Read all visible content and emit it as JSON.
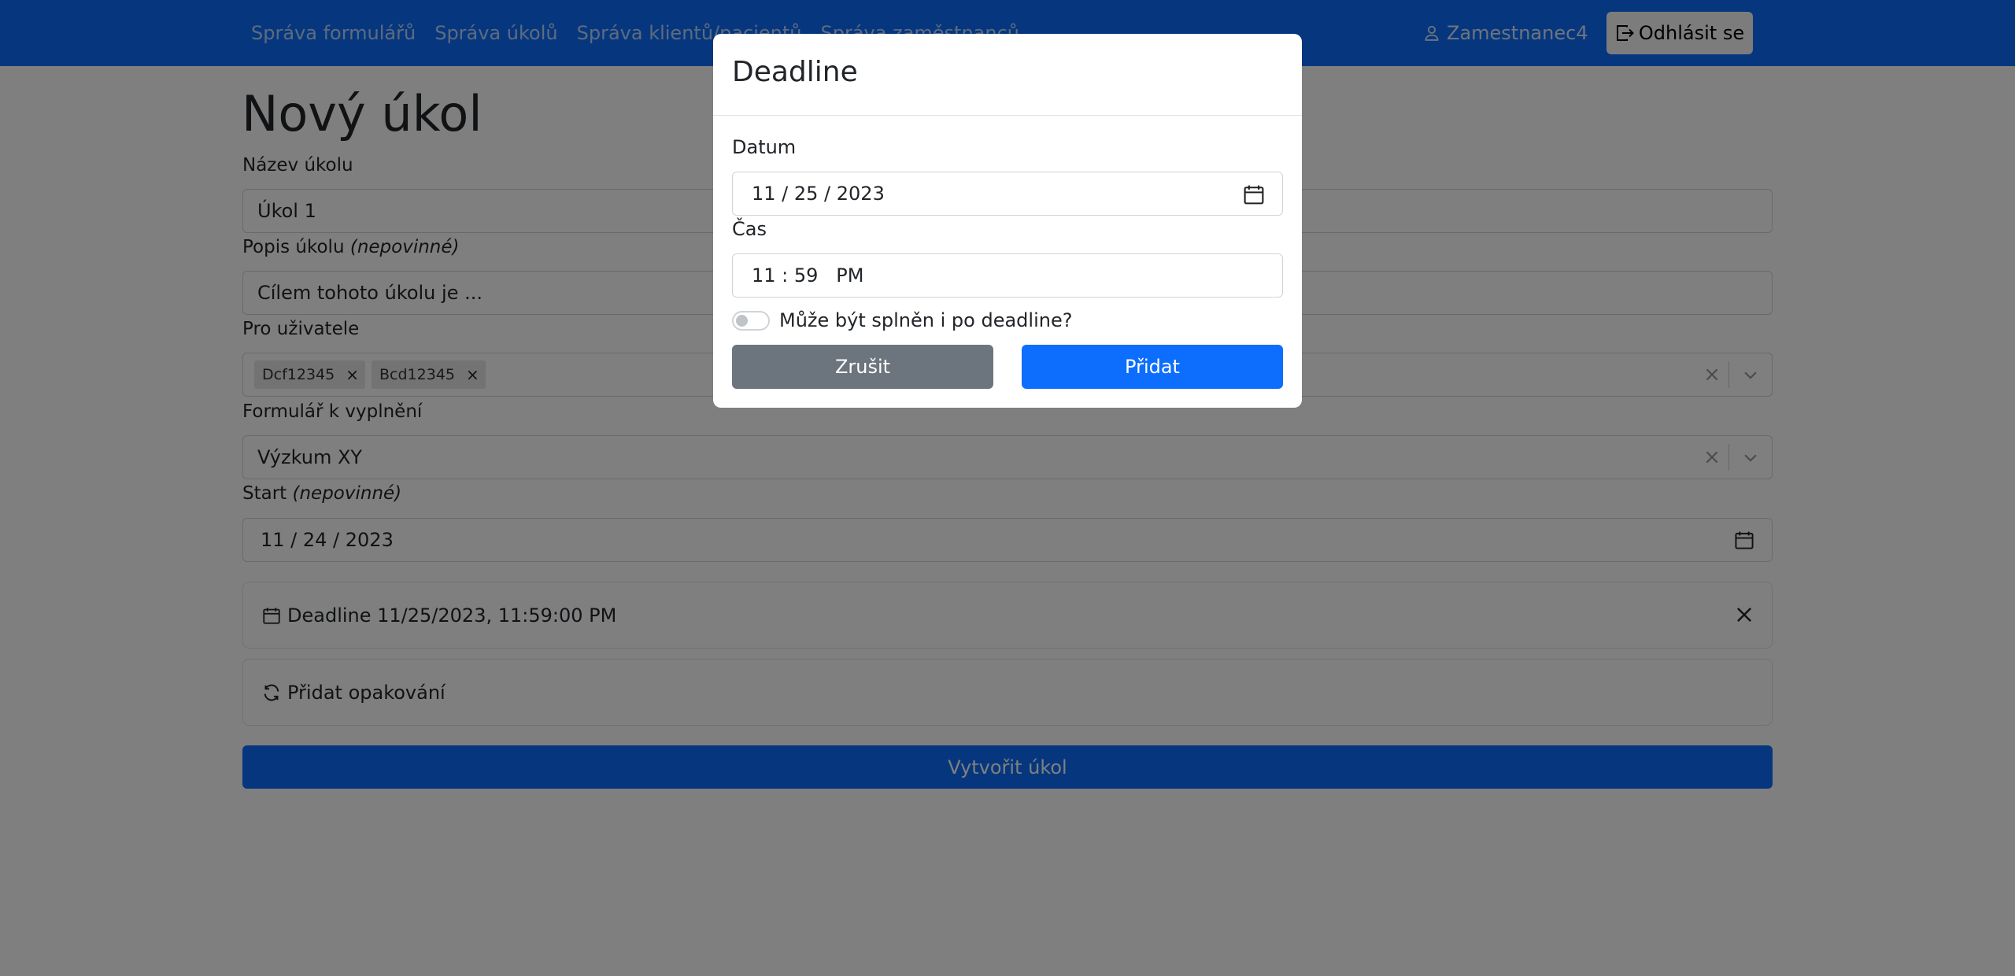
{
  "navbar": {
    "links": [
      "Správa formulářů",
      "Správa úkolů",
      "Správa klientů/pacientů",
      "Správa zaměstnanců"
    ],
    "user": "Zamestnanec4",
    "logout_label": "Odhlásit se"
  },
  "form": {
    "title": "Nový úkol",
    "task_name_label": "Název úkolu",
    "task_name_value": "Úkol 1",
    "description_label": "Popis úkolu",
    "optional_label": "(nepovinné)",
    "description_value": "Cílem tohoto úkolu je ...",
    "users_label": "Pro uživatele",
    "users": [
      "Dcf12345",
      "Bcd12345"
    ],
    "form_label": "Formulář k vyplnění",
    "form_value": "Výzkum XY",
    "start_label": "Start",
    "start_value": "11 / 24 / 2023",
    "deadline_card": "Deadline 11/25/2023, 11:59:00 PM",
    "repeat_card": "Přidat opakování",
    "create_button": "Vytvořit úkol"
  },
  "modal": {
    "title": "Deadline",
    "date_label": "Datum",
    "date_value": "11 / 25 / 2023",
    "time_label": "Čas",
    "time_value": "11 : 59   PM",
    "late_toggle_label": "Může být splněn i po deadline?",
    "late_toggle_on": false,
    "cancel_button": "Zrušit",
    "add_button": "Přidat"
  },
  "colors": {
    "primary": "#0d6efd",
    "secondary": "#6c757d",
    "backdrop": "rgba(0,0,0,0.5)"
  },
  "icons": [
    "person-icon",
    "logout-icon",
    "calendar-icon",
    "chevron-down-icon",
    "close-icon",
    "repeat-icon"
  ]
}
